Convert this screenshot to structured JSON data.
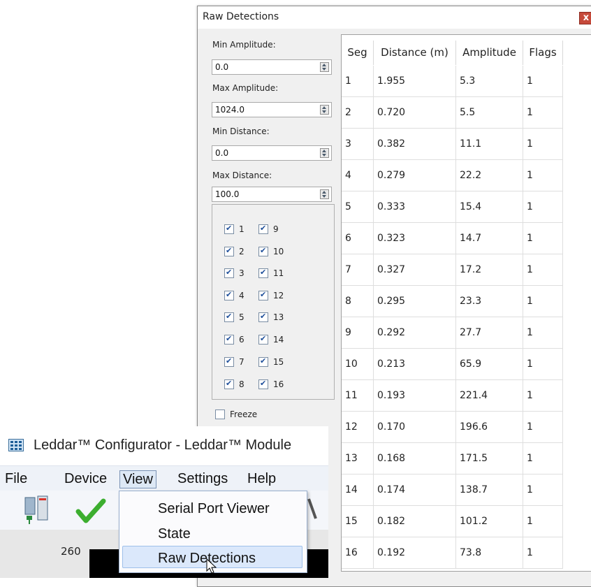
{
  "dialog": {
    "title": "Raw Detections",
    "close_icon": "close-icon",
    "min_amplitude": {
      "label": "Min Amplitude:",
      "value": "0.0"
    },
    "max_amplitude": {
      "label": "Max Amplitude:",
      "value": "1024.0"
    },
    "min_distance": {
      "label": "Min Distance:",
      "value": "0.0"
    },
    "max_distance": {
      "label": "Max Distance:",
      "value": "100.0"
    },
    "segments": [
      {
        "label": "1",
        "checked": true
      },
      {
        "label": "2",
        "checked": true
      },
      {
        "label": "3",
        "checked": true
      },
      {
        "label": "4",
        "checked": true
      },
      {
        "label": "5",
        "checked": true
      },
      {
        "label": "6",
        "checked": true
      },
      {
        "label": "7",
        "checked": true
      },
      {
        "label": "8",
        "checked": true
      },
      {
        "label": "9",
        "checked": true
      },
      {
        "label": "10",
        "checked": true
      },
      {
        "label": "11",
        "checked": true
      },
      {
        "label": "12",
        "checked": true
      },
      {
        "label": "13",
        "checked": true
      },
      {
        "label": "14",
        "checked": true
      },
      {
        "label": "15",
        "checked": true
      },
      {
        "label": "16",
        "checked": true
      }
    ],
    "freeze": {
      "label": "Freeze",
      "checked": false
    },
    "table": {
      "headers": [
        "Seg",
        "Distance (m)",
        "Amplitude",
        "Flags"
      ],
      "rows": [
        [
          "1",
          "1.955",
          "5.3",
          "1"
        ],
        [
          "2",
          "0.720",
          "5.5",
          "1"
        ],
        [
          "3",
          "0.382",
          "11.1",
          "1"
        ],
        [
          "4",
          "0.279",
          "22.2",
          "1"
        ],
        [
          "5",
          "0.333",
          "15.4",
          "1"
        ],
        [
          "6",
          "0.323",
          "14.7",
          "1"
        ],
        [
          "7",
          "0.327",
          "17.2",
          "1"
        ],
        [
          "8",
          "0.295",
          "23.3",
          "1"
        ],
        [
          "9",
          "0.292",
          "27.7",
          "1"
        ],
        [
          "10",
          "0.213",
          "65.9",
          "1"
        ],
        [
          "11",
          "0.193",
          "221.4",
          "1"
        ],
        [
          "12",
          "0.170",
          "196.6",
          "1"
        ],
        [
          "13",
          "0.168",
          "171.5",
          "1"
        ],
        [
          "14",
          "0.174",
          "138.7",
          "1"
        ],
        [
          "15",
          "0.182",
          "101.2",
          "1"
        ],
        [
          "16",
          "0.192",
          "73.8",
          "1"
        ]
      ]
    }
  },
  "app": {
    "title": "Leddar™ Configurator - Leddar™ Module",
    "menus": [
      "File",
      "Device",
      "View",
      "Settings",
      "Help"
    ],
    "active_menu": "View",
    "view_menu": [
      "Serial Port Viewer",
      "State",
      "Raw Detections"
    ],
    "hovered_item": "Raw Detections",
    "ruler_value": "260",
    "toolbar_icons": [
      "device-list-icon",
      "checkmark-icon",
      "search-icon"
    ]
  },
  "colors": {
    "accent": "#1f4f9a",
    "selection": "#dbe8fb",
    "close_button": "#c64a3b"
  }
}
